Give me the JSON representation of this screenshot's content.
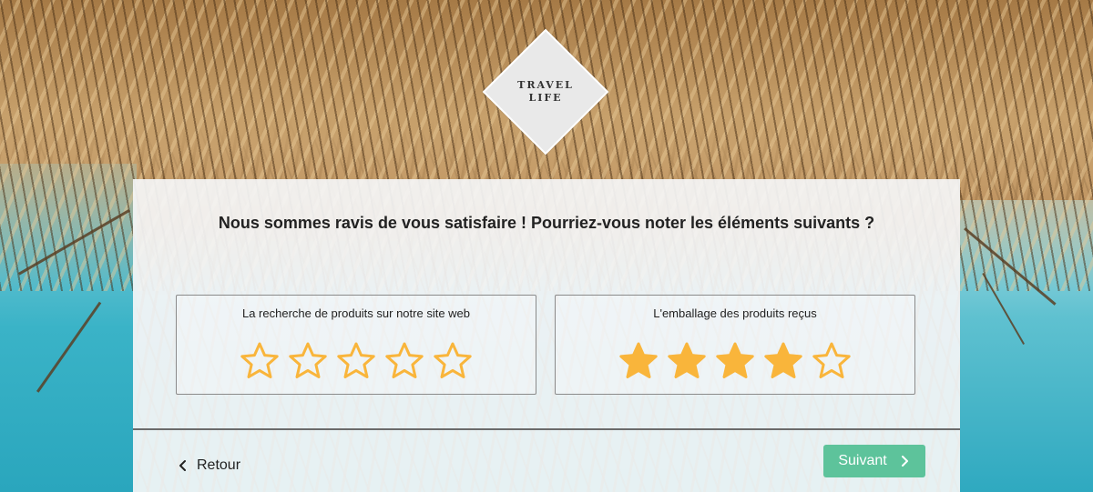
{
  "brand": {
    "line1": "TRAVEL",
    "line2": "LIFE"
  },
  "question": "Nous sommes ravis de vous satisfaire ! Pourriez-vous noter les éléments suivants ?",
  "ratings": [
    {
      "label": "La recherche de produits sur notre site web",
      "value": 0,
      "max": 5
    },
    {
      "label": "L'emballage des produits reçus",
      "value": 4,
      "max": 5
    }
  ],
  "nav": {
    "back_label": "Retour",
    "next_label": "Suivant"
  },
  "colors": {
    "star": "#f9b53b",
    "next_button": "#5dc39b"
  },
  "icons": {
    "back": "chevron-left-icon",
    "next": "chevron-right-icon",
    "star": "star-icon"
  }
}
